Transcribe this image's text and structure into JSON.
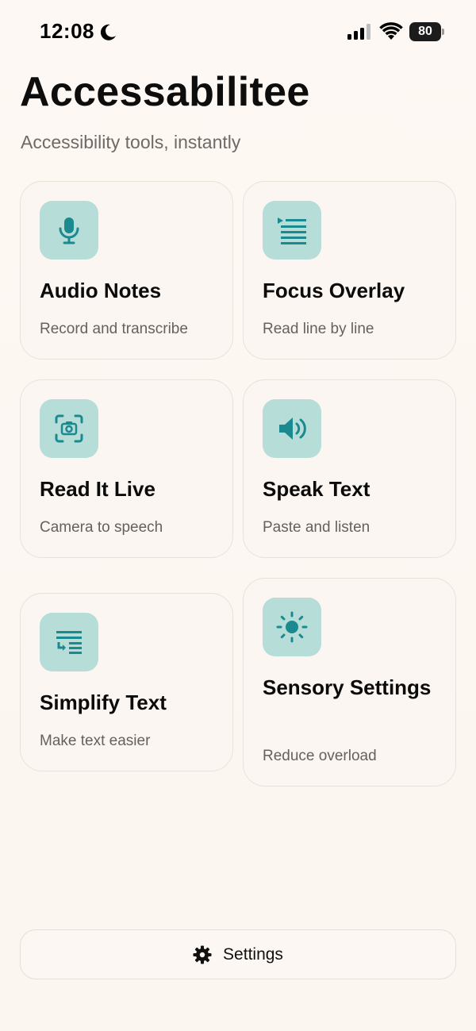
{
  "status_bar": {
    "time": "12:08",
    "battery": "80"
  },
  "header": {
    "title": "Accessabilitee",
    "subtitle": "Accessibility tools, instantly"
  },
  "cards": [
    {
      "title": "Audio Notes",
      "description": "Record and transcribe",
      "icon": "microphone-icon"
    },
    {
      "title": "Focus Overlay",
      "description": "Read line by line",
      "icon": "line-focus-icon"
    },
    {
      "title": "Read It Live",
      "description": "Camera to speech",
      "icon": "camera-scan-icon"
    },
    {
      "title": "Speak Text",
      "description": "Paste and listen",
      "icon": "speaker-icon"
    },
    {
      "title": "Simplify Text",
      "description": "Make text easier",
      "icon": "text-simplify-icon"
    },
    {
      "title": "Sensory Settings",
      "description": "Reduce overload",
      "icon": "sun-icon"
    }
  ],
  "footer": {
    "settings_label": "Settings",
    "icon": "gear-icon"
  },
  "colors": {
    "accent": "#1a8a90",
    "icon_tile": "#b6ddd8",
    "background": "#fdf8f3"
  }
}
